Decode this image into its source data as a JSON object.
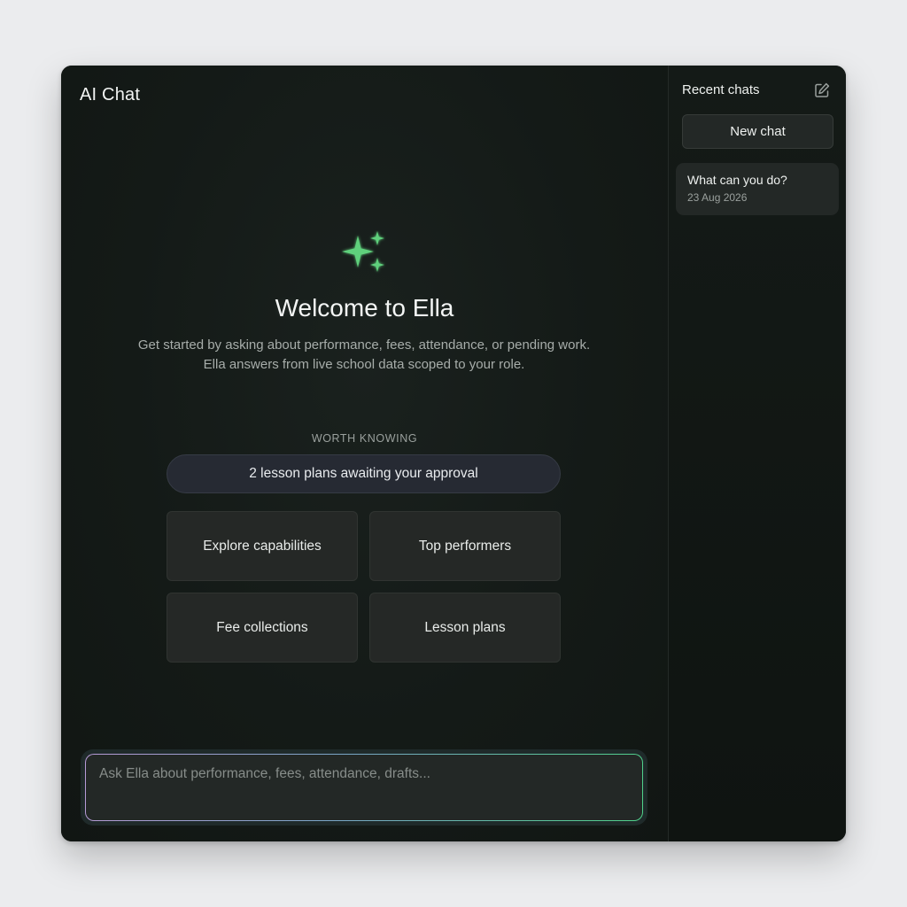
{
  "app": {
    "title": "AI Chat"
  },
  "welcome": {
    "icon": "sparkles-icon",
    "title": "Welcome to Ella",
    "subtitle": "Get started by asking about performance, fees, attendance, or pending work. Ella answers from live school data scoped to your role."
  },
  "worth_knowing": {
    "label": "WORTH KNOWING",
    "notice": "2 lesson plans awaiting your approval"
  },
  "suggestions": [
    {
      "label": "Explore capabilities"
    },
    {
      "label": "Top performers"
    },
    {
      "label": "Fee collections"
    },
    {
      "label": "Lesson plans"
    }
  ],
  "composer": {
    "placeholder": "Ask Ella about performance, fees, attendance, drafts...",
    "value": ""
  },
  "sidebar": {
    "title": "Recent chats",
    "edit_icon": "edit-icon",
    "new_chat_label": "New chat",
    "chats": [
      {
        "title": "What can you do?",
        "date": "23 Aug 2026"
      }
    ]
  },
  "colors": {
    "accent": "#5fd07c",
    "background": "#131916",
    "sidebar": "#0f1411",
    "card": "#252826",
    "pill": "#262a33"
  }
}
